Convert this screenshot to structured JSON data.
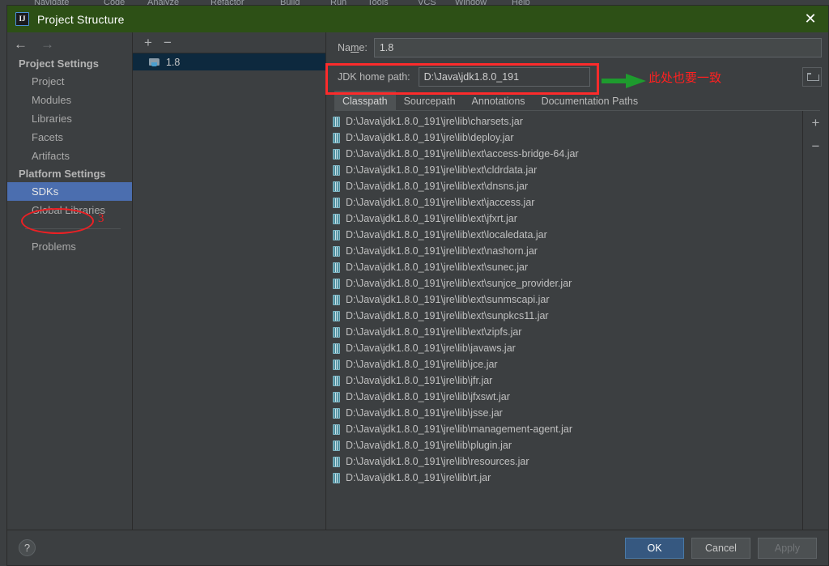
{
  "ide_menubar": [
    "Navigate",
    "Code",
    "Analyze",
    "Refactor",
    "Build",
    "Run",
    "Tools",
    "VCS",
    "Window",
    "Help"
  ],
  "window": {
    "title": "Project Structure",
    "app_icon": "intellij-idea-icon",
    "close_label": "✕"
  },
  "sidebar": {
    "back_icon": "←",
    "forward_icon": "→",
    "groups": [
      {
        "title": "Project Settings",
        "items": [
          {
            "label": "Project",
            "selected": false
          },
          {
            "label": "Modules",
            "selected": false
          },
          {
            "label": "Libraries",
            "selected": false
          },
          {
            "label": "Facets",
            "selected": false
          },
          {
            "label": "Artifacts",
            "selected": false
          }
        ]
      },
      {
        "title": "Platform Settings",
        "items": [
          {
            "label": "SDKs",
            "selected": true
          },
          {
            "label": "Global Libraries",
            "selected": false
          }
        ]
      }
    ],
    "problems": {
      "label": "Problems"
    },
    "annotation_number": "3"
  },
  "sdk_panel": {
    "add_label": "+",
    "remove_label": "−",
    "items": [
      {
        "label": "1.8",
        "selected": true
      }
    ]
  },
  "detail": {
    "name_label": "Name:",
    "name_value": "1.8",
    "jdk_label": "JDK home path:",
    "jdk_value": "D:\\Java\\jdk1.8.0_191",
    "browse_icon": "folder-icon",
    "annotation_text": "此处也要一致",
    "annotation_color": "#ff2020",
    "rect_color": "#fc2b2b",
    "arrow_color": "#1e9b2e",
    "tabs": [
      {
        "label": "Classpath",
        "active": true
      },
      {
        "label": "Sourcepath",
        "active": false
      },
      {
        "label": "Annotations",
        "active": false
      },
      {
        "label": "Documentation Paths",
        "active": false
      }
    ],
    "list_add_label": "+",
    "list_remove_label": "−",
    "classpath": [
      "D:\\Java\\jdk1.8.0_191\\jre\\lib\\charsets.jar",
      "D:\\Java\\jdk1.8.0_191\\jre\\lib\\deploy.jar",
      "D:\\Java\\jdk1.8.0_191\\jre\\lib\\ext\\access-bridge-64.jar",
      "D:\\Java\\jdk1.8.0_191\\jre\\lib\\ext\\cldrdata.jar",
      "D:\\Java\\jdk1.8.0_191\\jre\\lib\\ext\\dnsns.jar",
      "D:\\Java\\jdk1.8.0_191\\jre\\lib\\ext\\jaccess.jar",
      "D:\\Java\\jdk1.8.0_191\\jre\\lib\\ext\\jfxrt.jar",
      "D:\\Java\\jdk1.8.0_191\\jre\\lib\\ext\\localedata.jar",
      "D:\\Java\\jdk1.8.0_191\\jre\\lib\\ext\\nashorn.jar",
      "D:\\Java\\jdk1.8.0_191\\jre\\lib\\ext\\sunec.jar",
      "D:\\Java\\jdk1.8.0_191\\jre\\lib\\ext\\sunjce_provider.jar",
      "D:\\Java\\jdk1.8.0_191\\jre\\lib\\ext\\sunmscapi.jar",
      "D:\\Java\\jdk1.8.0_191\\jre\\lib\\ext\\sunpkcs11.jar",
      "D:\\Java\\jdk1.8.0_191\\jre\\lib\\ext\\zipfs.jar",
      "D:\\Java\\jdk1.8.0_191\\jre\\lib\\javaws.jar",
      "D:\\Java\\jdk1.8.0_191\\jre\\lib\\jce.jar",
      "D:\\Java\\jdk1.8.0_191\\jre\\lib\\jfr.jar",
      "D:\\Java\\jdk1.8.0_191\\jre\\lib\\jfxswt.jar",
      "D:\\Java\\jdk1.8.0_191\\jre\\lib\\jsse.jar",
      "D:\\Java\\jdk1.8.0_191\\jre\\lib\\management-agent.jar",
      "D:\\Java\\jdk1.8.0_191\\jre\\lib\\plugin.jar",
      "D:\\Java\\jdk1.8.0_191\\jre\\lib\\resources.jar",
      "D:\\Java\\jdk1.8.0_191\\jre\\lib\\rt.jar"
    ]
  },
  "footer": {
    "help_label": "?",
    "ok_label": "OK",
    "cancel_label": "Cancel",
    "apply_label": "Apply",
    "apply_enabled": false
  }
}
